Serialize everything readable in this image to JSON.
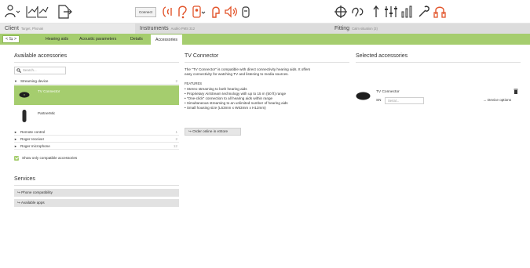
{
  "toolbar": {
    "connect_label": "Connect",
    "accent_color": "#e2542a",
    "brand_green": "#a5cd6e",
    "left_icons": [
      "user-menu-icon",
      "sessions-icon",
      "export-icon"
    ],
    "center_icons": [
      "hearing-aid-left-icon",
      "hearing-aid-right-icon",
      "device-status-icon",
      "earpiece-icon",
      "streamer-icon",
      "battery-icon"
    ],
    "right_icons": [
      "sync-icon",
      "feedback-test-icon",
      "audiogram-icon",
      "fine-tuning-icon",
      "equalizer-icon",
      "tools-icon",
      "lock-icon"
    ]
  },
  "sections": {
    "client": {
      "label": "Client",
      "sub": "Target, Phonak"
    },
    "instruments": {
      "label": "Instruments",
      "sub": "Audéo PMS 312"
    },
    "fitting": {
      "label": "Fitting",
      "sub": "Calm situation (3)"
    }
  },
  "tabs": {
    "nav": "< ⇆ >",
    "items": [
      "Hearing aids",
      "Acoustic parameters",
      "Details",
      "Accessories"
    ],
    "active": "Accessories"
  },
  "available": {
    "title": "Available accessories",
    "search_placeholder": "Search...",
    "categories": [
      {
        "label": "Streaming device",
        "count": "2",
        "expanded": true
      },
      {
        "label": "Remote control",
        "count": "1",
        "expanded": false
      },
      {
        "label": "Roger receiver",
        "count": "2",
        "expanded": false
      },
      {
        "label": "Roger microphone",
        "count": "12",
        "expanded": false
      }
    ],
    "items": [
      "TV Connector",
      "PartnerMic"
    ],
    "compatible_label": "Show only compatible accessories"
  },
  "services": {
    "title": "Services",
    "items": [
      "Phone compatibility",
      "Available apps"
    ]
  },
  "details": {
    "title": "TV Connector",
    "description_1": "The \"TV Connector\" is compatible with direct connectivity hearing aids. It offers",
    "description_2": "easy connectivity for watching TV and listening to media sources.",
    "features_title": "FEATURES",
    "features": [
      "• Stereo streaming to both hearing aids",
      "• Proprietary AirStream technology with up to 15 m (50 ft) range",
      "• \"One-click\" connection to all hearing aids within range",
      "• Simultaneous streaming to an unlimited number of hearing aids",
      "• Small housing size (L63mm x W63mm x H12mm)"
    ],
    "order_label": "Order online in eStore"
  },
  "selected": {
    "title": "Selected accessories",
    "item_name": "TV Connector",
    "sn_label": "SN",
    "serial_placeholder": "Serial...",
    "device_options_label": "Device options"
  }
}
